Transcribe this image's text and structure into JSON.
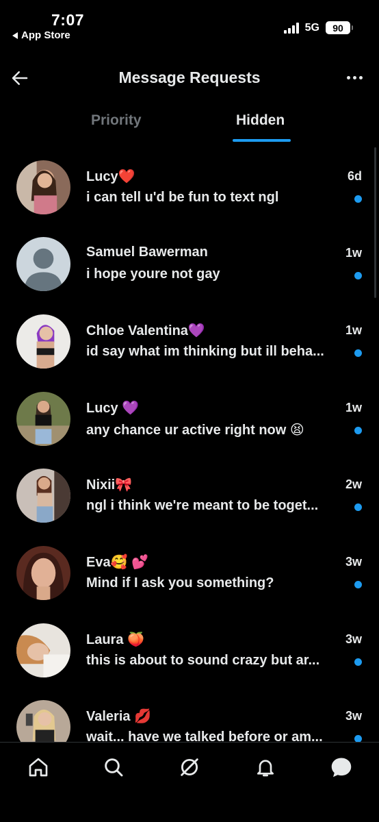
{
  "status_bar": {
    "time": "7:07",
    "back_app": "App Store",
    "network": "5G",
    "battery": "90"
  },
  "header": {
    "title": "Message Requests",
    "back_icon": "arrow-left-icon",
    "more_icon": "more-horizontal-icon"
  },
  "tabs": [
    {
      "label": "Priority",
      "selected": false
    },
    {
      "label": "Hidden",
      "selected": true
    }
  ],
  "accent_color": "#1d9bf0",
  "messages": [
    {
      "name": "Lucy❤️",
      "preview": "i can tell u'd be fun to text ngl",
      "time": "6d",
      "unread": true
    },
    {
      "name": "Samuel Bawerman",
      "preview": "i hope youre not gay",
      "time": "1w",
      "unread": true
    },
    {
      "name": "Chloe Valentina💜",
      "preview": "id say what im thinking but ill beha...",
      "time": "1w",
      "unread": true
    },
    {
      "name": "Lucy 💜",
      "preview": "any chance ur active right now 😫",
      "time": "1w",
      "unread": true
    },
    {
      "name": "Nixii🎀",
      "preview": "ngl i think we're meant to be toget...",
      "time": "2w",
      "unread": true
    },
    {
      "name": "Eva🥰 💕",
      "preview": "Mind if I ask you something?",
      "time": "3w",
      "unread": true
    },
    {
      "name": "Laura 🍑",
      "preview": "this is about to sound crazy but ar...",
      "time": "3w",
      "unread": true
    },
    {
      "name": "Valeria 💋",
      "preview": "wait... have we talked before or am...",
      "time": "3w",
      "unread": true
    }
  ],
  "bottom_nav": [
    {
      "icon": "home-icon"
    },
    {
      "icon": "search-icon"
    },
    {
      "icon": "grok-icon"
    },
    {
      "icon": "bell-icon"
    },
    {
      "icon": "messages-icon"
    }
  ]
}
